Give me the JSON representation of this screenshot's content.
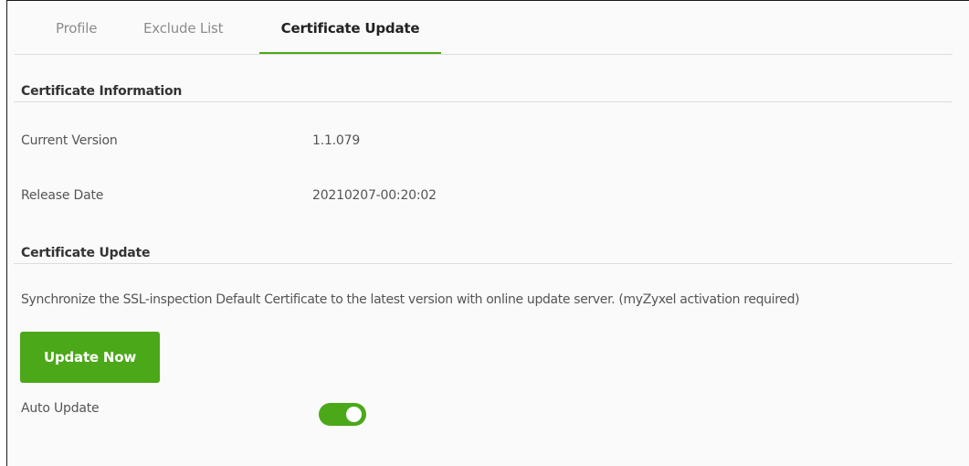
{
  "tabs": [
    {
      "label": "Profile",
      "active": false
    },
    {
      "label": "Exclude List",
      "active": false
    },
    {
      "label": "Certificate Update",
      "active": true
    }
  ],
  "cert_info": {
    "title": "Certificate Information",
    "current_version_label": "Current Version",
    "current_version_value": "1.1.079",
    "release_date_label": "Release Date",
    "release_date_value": "20210207-00:20:02"
  },
  "cert_update": {
    "title": "Certificate Update",
    "description": "Synchronize the SSL-inspection Default Certificate to the latest version with online update server. (myZyxel activation required)",
    "button_label": "Update Now",
    "auto_update_label": "Auto Update",
    "auto_update_enabled": true
  },
  "colors": {
    "accent": "#4ba819",
    "text": "#333333",
    "muted_tab": "#8c8c8c"
  }
}
